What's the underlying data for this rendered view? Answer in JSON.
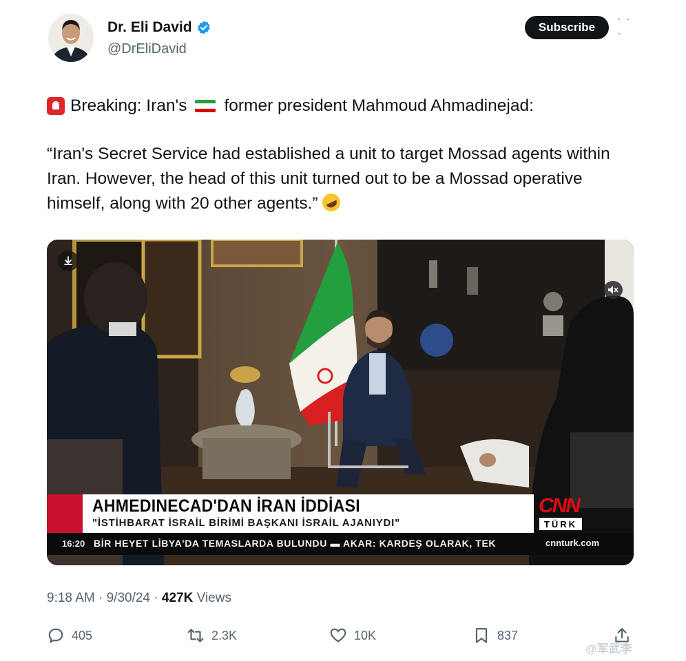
{
  "author": {
    "name": "Dr. Eli David",
    "handle": "@DrEliDavid",
    "verified": true,
    "verified_color": "#1d9bf0"
  },
  "subscribe_label": "Subscribe",
  "more_icon": "ellipsis-icon",
  "tweet": {
    "prefix_emoji": "police-siren-emoji",
    "line1_before_flag": "Breaking: Iran's",
    "flag_emoji": "iran-flag-emoji",
    "line1_after_flag": "former president Mahmoud Ahmadinejad:",
    "quote": "“Iran's Secret Service had established a unit to target Mossad agents within Iran. However, the head of this unit turned out to be a Mossad operative himself, along with 20 other agents.”",
    "suffix_emoji": "rolling-on-floor-laughing-emoji"
  },
  "video": {
    "download_icon": "download-icon",
    "headline": "AHMEDINECAD'DAN İRAN İDDİASI",
    "subheadline": "\"İSTİHBARAT İSRAİL BİRİMİ BAŞKANI İSRAİL AJANIYDI\"",
    "network": "CNN",
    "network_sub": "TÜRK",
    "ticker_time": "16:20",
    "ticker_text": "BİR HEYET LİBYA'DA TEMASLARDA BULUNDU   ▬   AKAR: KARDEŞ OLARAK, TEK",
    "ticker_site": "cnnturk.com",
    "mute_icon": "mute-icon"
  },
  "meta": {
    "time": "9:18 AM",
    "date": "9/30/24",
    "views_count": "427K",
    "views_label": "Views"
  },
  "actions": {
    "replies": "405",
    "reposts": "2.3K",
    "likes": "10K",
    "bookmarks": "837"
  },
  "watermark": "@军武李",
  "colors": {
    "text": "#0f1419",
    "secondary": "#536471",
    "cnn_red": "#e50914",
    "banner_red": "#c8102e"
  }
}
